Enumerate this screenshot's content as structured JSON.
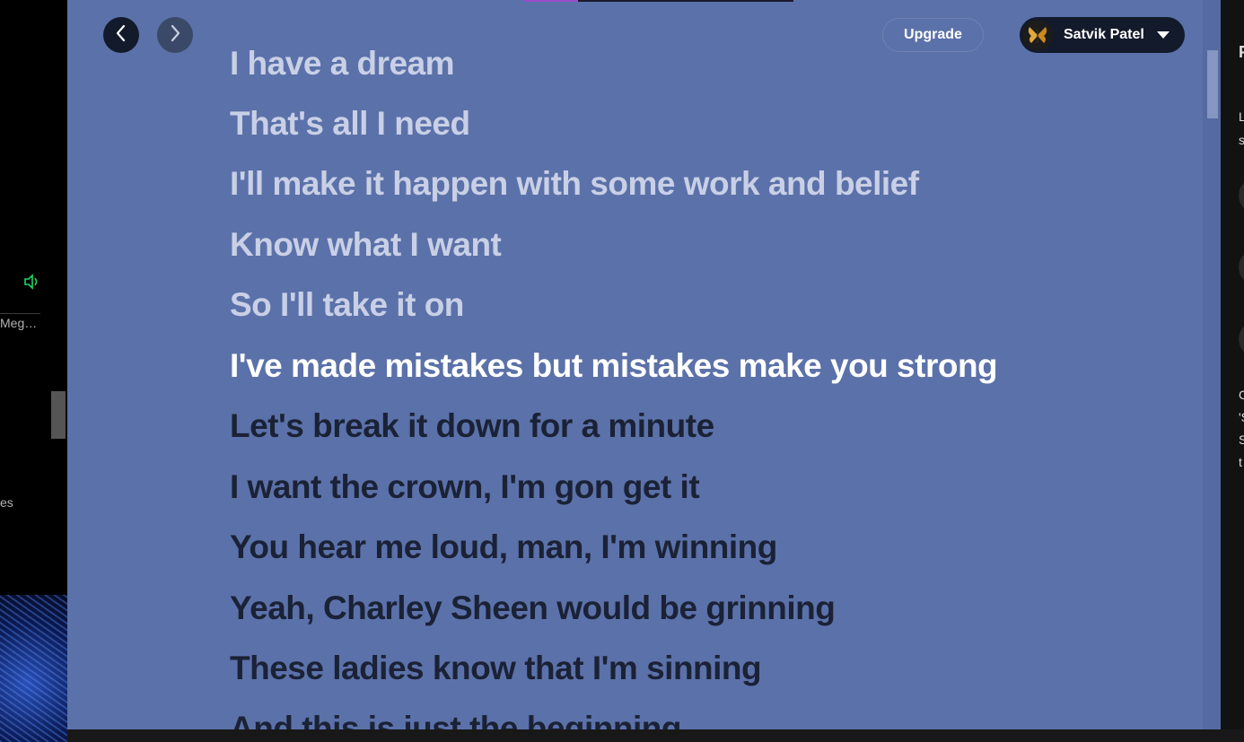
{
  "left_sidebar": {
    "item_text": "Meg…",
    "item_text_2": "es"
  },
  "header": {
    "upgrade_label": "Upgrade",
    "user_name": "Satvik Patel"
  },
  "lyrics": {
    "lines": [
      {
        "text": "I have a dream",
        "state": "past"
      },
      {
        "text": "That's all I need",
        "state": "past"
      },
      {
        "text": "I'll make it happen with some work and belief",
        "state": "past"
      },
      {
        "text": "Know what I want",
        "state": "past"
      },
      {
        "text": "So I'll take it on",
        "state": "past"
      },
      {
        "text": "I've made mistakes but mistakes make you strong",
        "state": "current"
      },
      {
        "text": "Let's break it down for a minute",
        "state": "future"
      },
      {
        "text": "I want the crown, I'm gon get it",
        "state": "future"
      },
      {
        "text": "You hear me loud, man, I'm winning",
        "state": "future"
      },
      {
        "text": "Yeah, Charley Sheen would be grinning",
        "state": "future"
      },
      {
        "text": "These ladies know that I'm sinning",
        "state": "future"
      },
      {
        "text": "And this is just the beginning",
        "state": "future"
      }
    ]
  },
  "right_sidebar": {
    "heading": "F",
    "text_lines": [
      "L",
      "s",
      "C",
      "'S",
      "S",
      "t"
    ]
  },
  "colors": {
    "lyrics_background": "#5b71a9",
    "current_line": "#ffffff",
    "past_line": "#c9d0e6",
    "future_line": "#1b2236",
    "accent_green": "#1ed760"
  }
}
